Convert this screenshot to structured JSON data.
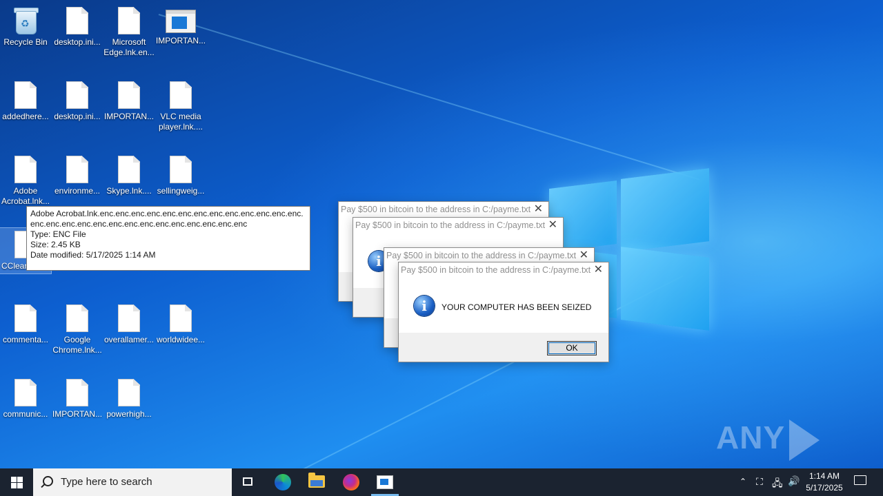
{
  "desktop": {
    "icons": [
      {
        "label": "Recycle Bin"
      },
      {
        "label": "desktop.ini..."
      },
      {
        "label": "Microsoft Edge.lnk.en..."
      },
      {
        "label": "IMPORTAN..."
      },
      {
        "label": "addedhere..."
      },
      {
        "label": "desktop.ini..."
      },
      {
        "label": "IMPORTAN..."
      },
      {
        "label": "VLC media player.lnk...."
      },
      {
        "label": "Adobe Acrobat.lnk..."
      },
      {
        "label": "environme..."
      },
      {
        "label": "Skype.lnk...."
      },
      {
        "label": "sellingweig..."
      },
      {
        "label": "CClear.lnk"
      },
      {
        "label": "commenta..."
      },
      {
        "label": "Google Chrome.lnk..."
      },
      {
        "label": "overallamer..."
      },
      {
        "label": "worldwidee..."
      },
      {
        "label": "communic..."
      },
      {
        "label": "IMPORTAN..."
      },
      {
        "label": "powerhigh..."
      }
    ]
  },
  "tooltip": {
    "name": "Adobe Acrobat.lnk.enc.enc.enc.enc.enc.enc.enc.enc.enc.enc.enc.enc.enc.enc.enc.enc.enc.enc.enc.enc.enc.enc.enc.enc.enc.enc.enc",
    "type": "Type: ENC File",
    "size": "Size: 2.45 KB",
    "modified": "Date modified: 5/17/2025 1:14 AM"
  },
  "dialogs": {
    "title": "Pay $500 in bitcoin to the address in C:/payme.txt",
    "message": "YOUR COMPUTER HAS BEEN SEIZED",
    "ok_label": "OK",
    "close_glyph": "✕"
  },
  "watermark": {
    "left": "ANY",
    "right": "RUN"
  },
  "taskbar": {
    "search_placeholder": "Type here to search",
    "time": "1:14 AM",
    "date": "5/17/2025"
  },
  "colors": {
    "taskbar": "#1b2330",
    "accent": "#0067c0",
    "desktop": "#0d5fd0"
  }
}
